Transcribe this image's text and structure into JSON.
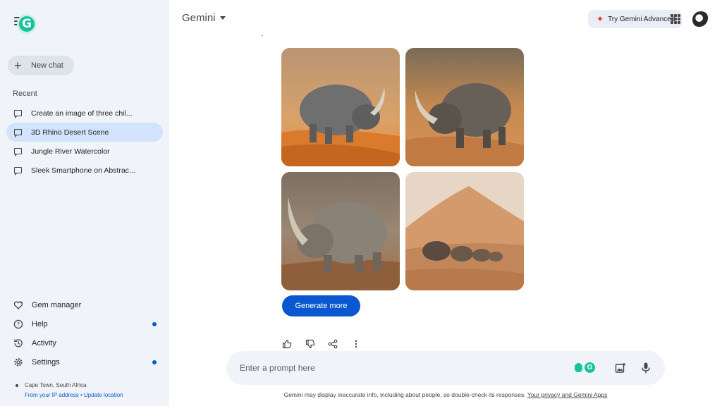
{
  "sidebar": {
    "new_chat": "New chat",
    "recent_label": "Recent",
    "recent": [
      {
        "label": "Create an image of three chil..."
      },
      {
        "label": "3D Rhino Desert Scene"
      },
      {
        "label": "Jungle River Watercolor"
      },
      {
        "label": "Sleek Smartphone on Abstrac..."
      }
    ],
    "nav": {
      "gem_manager": "Gem manager",
      "help": "Help",
      "activity": "Activity",
      "settings": "Settings"
    },
    "location": {
      "place": "Cape Town, South Africa",
      "from_ip": "From your IP address",
      "separator": " • ",
      "update": "Update location"
    }
  },
  "header": {
    "brand": "Gemini",
    "try_advanced": "Try Gemini Advanced"
  },
  "response": {
    "generate_more": "Generate more"
  },
  "prompt": {
    "placeholder": "Enter a prompt here"
  },
  "footer": {
    "disclaimer": "Gemini may display inaccurate info, including about people, so double-check its responses.",
    "privacy_link": "Your privacy and Gemini Apps"
  },
  "colors": {
    "accent": "#0b57d0",
    "sidebar_bg": "#f0f4f9",
    "active_item": "#d3e3fd",
    "grammarly": "#15c39a"
  }
}
